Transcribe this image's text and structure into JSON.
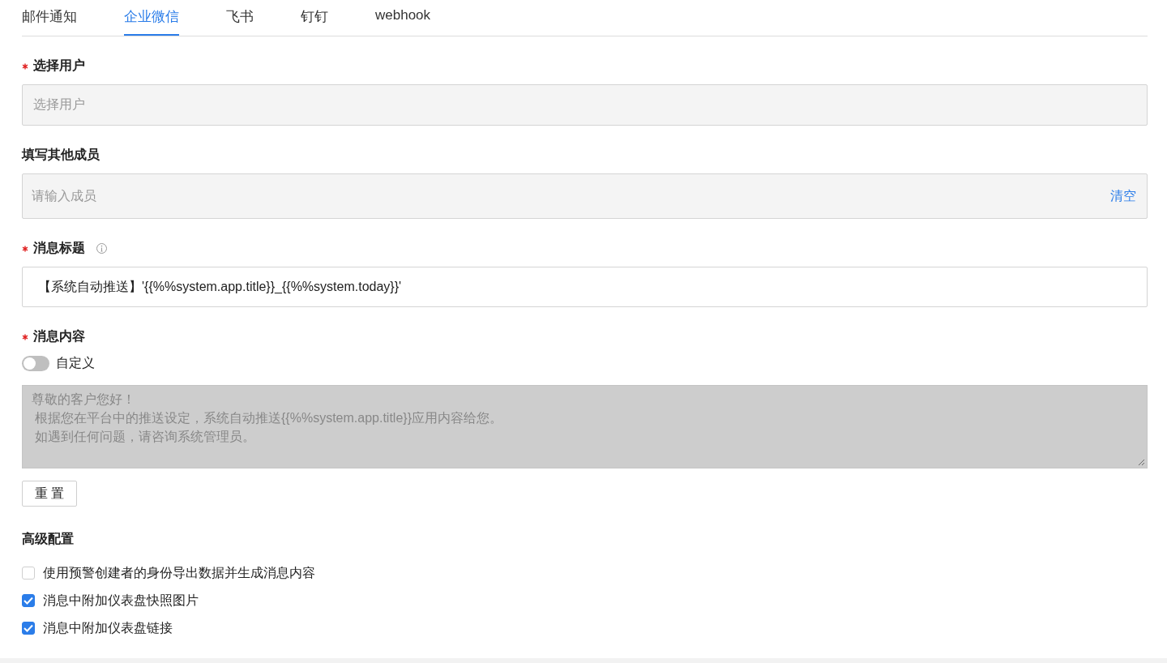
{
  "tabs": [
    {
      "label": "邮件通知",
      "selected": false
    },
    {
      "label": "企业微信",
      "selected": true
    },
    {
      "label": "飞书",
      "selected": false
    },
    {
      "label": "钉钉",
      "selected": false
    },
    {
      "label": "webhook",
      "selected": false
    }
  ],
  "fields": [
    {
      "kind": "select",
      "label": "选择用户",
      "required": true,
      "info": false,
      "placeholder": "选择用户"
    },
    {
      "kind": "members",
      "label": "填写其他成员",
      "required": false,
      "info": false,
      "placeholder": "请输入成员",
      "action": "清空"
    },
    {
      "kind": "text",
      "label": "消息标题",
      "required": true,
      "info": true,
      "value": "【系统自动推送】'{{%%system.app.title}}_{{%%system.today}}'"
    }
  ],
  "content": {
    "label": "消息内容",
    "required": true,
    "custom": {
      "label": "自定义",
      "on": false
    },
    "lines": [
      "尊敬的客户您好！",
      "根据您在平台中的推送设定，系统自动推送{{%%system.app.title}}应用内容给您。",
      "如遇到任何问题，请咨询系统管理员。"
    ],
    "reset": "重 置"
  },
  "advanced": {
    "title": "高级配置",
    "options": [
      {
        "label": "使用预警创建者的身份导出数据并生成消息内容",
        "checked": false
      },
      {
        "label": "消息中附加仪表盘快照图片",
        "checked": true
      },
      {
        "label": "消息中附加仪表盘链接",
        "checked": true
      }
    ]
  }
}
